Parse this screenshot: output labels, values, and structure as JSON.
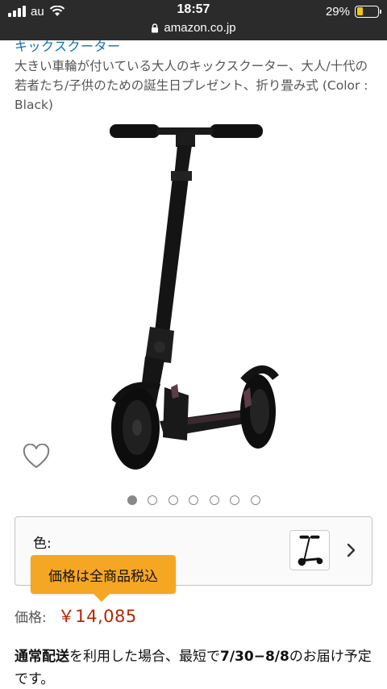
{
  "status_bar": {
    "carrier": "au",
    "time": "18:57",
    "battery_percent": "29%",
    "battery_level": 0.29,
    "url": "amazon.co.jp"
  },
  "product": {
    "brand": "キックスクーター",
    "title": "大きい車輪が付いている大人のキックスクーター、大人/十代の若者たち/子供のための誕生日プレゼント、折り畳み式 (Color : Black)",
    "image_count": 7,
    "active_image_index": 0
  },
  "variation": {
    "color_label": "色:"
  },
  "tooltip": {
    "text": "価格は全商品税込"
  },
  "price": {
    "label": "価格:",
    "value": "￥14,085"
  },
  "delivery": {
    "part1": "通常配送",
    "part2": "を利用した場合、最短で",
    "part3": "7/30−8/8",
    "part4": "のお届け予定です。"
  },
  "colors": {
    "status_bar_bg": "#2b2b2b",
    "brand_link": "#0f6fb8",
    "price": "#b12704",
    "tooltip_bg": "#f5a623",
    "battery_fill": "#f4c40f"
  }
}
